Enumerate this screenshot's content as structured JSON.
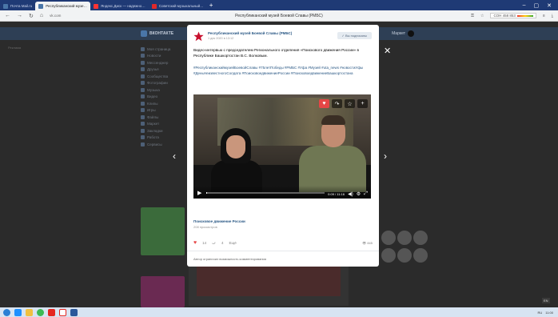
{
  "browser": {
    "tabs": [
      {
        "label": "Почта Mail.ru",
        "icon": "mail-icon"
      },
      {
        "label": "Республиканский музе…",
        "icon": "vk-icon",
        "active": true
      },
      {
        "label": "Яндекс.Диск — надежно…",
        "icon": "yandex-icon"
      },
      {
        "label": "Советский музыкальный…",
        "icon": "music-icon"
      }
    ],
    "new_tab": "+",
    "url": "vk.com",
    "page_title": "Республиканский музей Боевой Славы (РМБС)",
    "money_label": "СОН 458 853"
  },
  "vk": {
    "logo_text": "ВКОНТАКТЕ",
    "search_placeholder": "Поиск",
    "user_name": "Маркет",
    "left_menu": [
      "Моя страница",
      "Новости",
      "Мессенджер",
      "Друзья",
      "Сообщества",
      "Фотографии",
      "Музыка",
      "Видео",
      "Клипы",
      "Игры",
      "Файлы",
      "Маркет",
      "Закладки",
      "Работа",
      "Сервисы"
    ],
    "side_blank": "Реклама"
  },
  "post": {
    "group_name": "Республиканский музей Боевой Славы (РМБС)",
    "date": "1 дек 2020 в 13:12",
    "subscribed_label": "✓ Вы подписаны",
    "text": "Видео-интервью с председателем Регионального отделения «Поискового движения России» в Республике Башкортостан В.С. Волковым.",
    "tags": "#РеспубликанскиймузейБоевойСлавы #75летПобеды #РМБС #Уфа #Музей #uta_news #новостиУфы #ДеньНеизвестногоСолдата #ПоисковоедвижениеРоссии #ПоисковоедвижениеБашкортостана",
    "video": {
      "time": "0:09 / 11:16",
      "progress": 0.01,
      "title": "Поисковое движение России",
      "views": "208 просмотров"
    },
    "likes": "14",
    "shares": "4",
    "share_label": "Ещё",
    "views_count": "👁 845",
    "comments_note": "Автор ограничил возможность комментирования"
  },
  "overlay": {
    "close": "✕",
    "prev": "‹",
    "next": "›"
  },
  "taskbar": {
    "lang": "RU",
    "time": "11:00",
    "layout_badge": "EN"
  }
}
